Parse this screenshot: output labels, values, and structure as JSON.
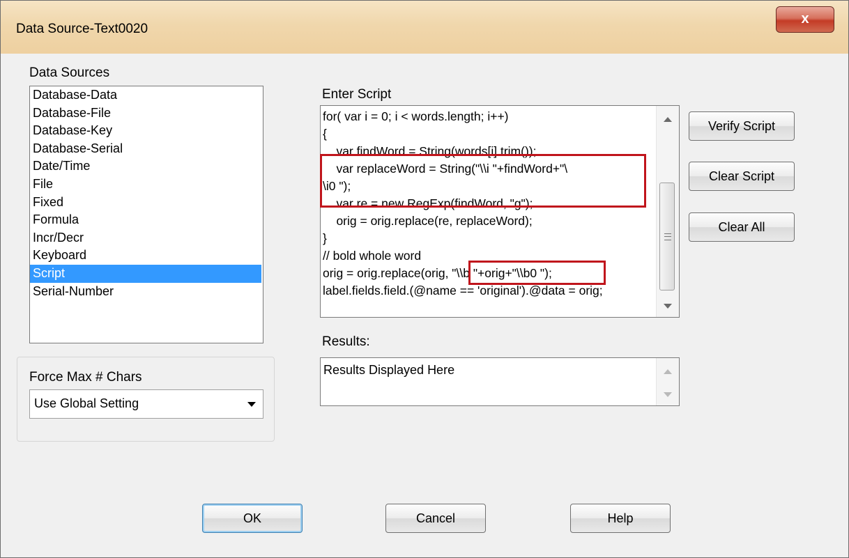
{
  "window": {
    "title": "Data Source-Text0020",
    "close_label": "x"
  },
  "data_sources": {
    "label": "Data Sources",
    "items": [
      "Database-Data",
      "Database-File",
      "Database-Key",
      "Database-Serial",
      "Date/Time",
      "File",
      "Fixed",
      "Formula",
      "Incr/Decr",
      "Keyboard",
      "Script",
      "Serial-Number"
    ],
    "selected": "Script"
  },
  "force_max": {
    "label": "Force Max # Chars",
    "value": "Use Global Setting"
  },
  "script": {
    "label": "Enter Script",
    "text": "for( var i = 0; i < words.length; i++)\n{\n    var findWord = String(words[i].trim());\n    var replaceWord = String(\"\\\\i \"+findWord+\"\\\n\\i0 \");\n    var re = new RegExp(findWord, \"g\");\n    orig = orig.replace(re, replaceWord);\n}\n// bold whole word\norig = orig.replace(orig, \"\\\\b \"+orig+\"\\\\b0 \");\nlabel.fields.field.(@name == 'original').@data = orig;"
  },
  "results": {
    "label": "Results:",
    "text": "Results Displayed Here"
  },
  "buttons": {
    "verify": "Verify Script",
    "clear_script": "Clear Script",
    "clear_all": "Clear All",
    "ok": "OK",
    "cancel": "Cancel",
    "help": "Help"
  },
  "colors": {
    "selection": "#3399ff",
    "highlight_box": "#c0151c",
    "titlebar": "#f0d7ac"
  }
}
